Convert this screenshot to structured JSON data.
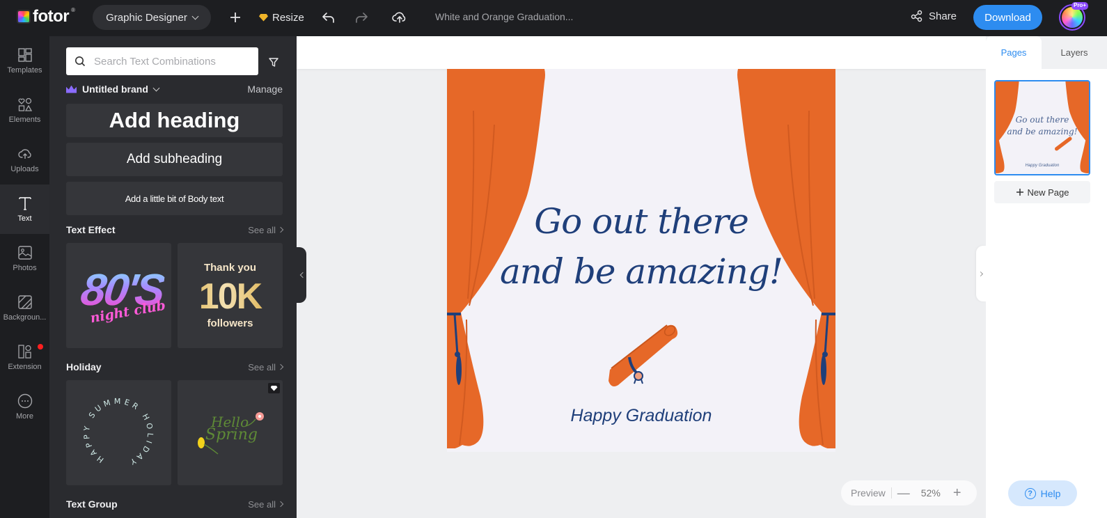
{
  "topbar": {
    "logo_text": "fotor",
    "logo_reg": "®",
    "role_label": "Graphic Designer",
    "resize_label": "Resize",
    "document_title": "White and Orange Graduation...",
    "share_label": "Share",
    "download_label": "Download",
    "avatar_badge": "Pro+"
  },
  "rail": {
    "items": [
      {
        "label": "Templates",
        "icon": "templates-icon"
      },
      {
        "label": "Elements",
        "icon": "elements-icon"
      },
      {
        "label": "Uploads",
        "icon": "upload-icon"
      },
      {
        "label": "Text",
        "icon": "text-icon",
        "active": true
      },
      {
        "label": "Photos",
        "icon": "photo-icon"
      },
      {
        "label": "Backgroun...",
        "icon": "background-icon"
      },
      {
        "label": "Extension",
        "icon": "extension-icon",
        "notification": true
      },
      {
        "label": "More",
        "icon": "more-icon"
      }
    ]
  },
  "panel": {
    "search_placeholder": "Search Text Combinations",
    "brand_name": "Untitled brand",
    "manage_label": "Manage",
    "add_heading": "Add heading",
    "add_subheading": "Add subheading",
    "add_body": "Add a little bit of Body text",
    "sections": [
      {
        "title": "Text Effect",
        "see_all": "See all",
        "tiles": [
          {
            "line1": "80'S",
            "line2": "night club"
          },
          {
            "line1": "Thank you",
            "line2": "10K",
            "line3": "followers"
          }
        ]
      },
      {
        "title": "Holiday",
        "see_all": "See all",
        "tiles": [
          {
            "text": "HAPPY SUMMER HOLIDAY"
          },
          {
            "line1": "Hello",
            "line2": "Spring",
            "premium": true
          }
        ]
      },
      {
        "title": "Text Group",
        "see_all": "See all"
      }
    ]
  },
  "canvas": {
    "quote_line1": "Go out there",
    "quote_line2": "and be amazing!",
    "subtitle": "Happy Graduation",
    "colors": {
      "curtain": "#e66828",
      "curtain_fold": "#d15a20",
      "text": "#1f3f7a",
      "background": "#f3f2f8"
    }
  },
  "zoom_bar": {
    "preview_label": "Preview",
    "minus": "—",
    "zoom_value": "52%",
    "plus": "+"
  },
  "right_panel": {
    "tab_pages": "Pages",
    "tab_layers": "Layers",
    "thumb_line1": "Go out there",
    "thumb_line2": "and be amazing!",
    "thumb_subtitle": "Happy Graduation",
    "new_page_label": "New Page",
    "help_label": "Help"
  },
  "colors": {
    "accent": "#2d8cf0",
    "topbar_bg": "#1d1e21",
    "panel_bg": "#2a2b2f",
    "tile_bg": "#35363a"
  }
}
